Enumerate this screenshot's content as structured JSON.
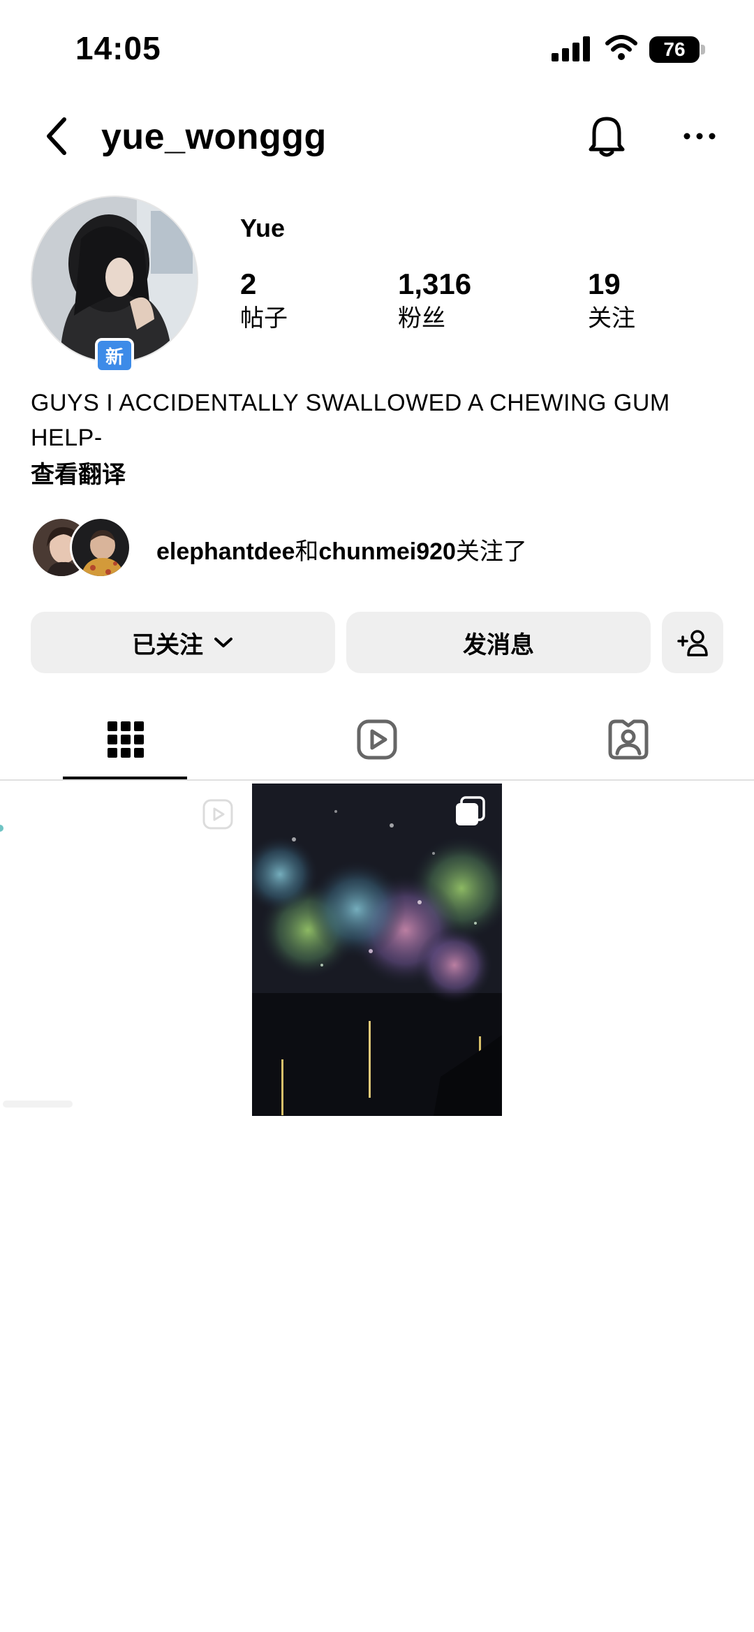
{
  "status_bar": {
    "time": "14:05",
    "battery": "76",
    "icons": [
      "signal-icon",
      "wifi-icon",
      "battery-icon"
    ]
  },
  "header": {
    "username": "yue_wonggg",
    "icons": [
      "back-arrow-icon",
      "bell-icon",
      "more-icon"
    ]
  },
  "profile": {
    "badge": "新",
    "display_name": "Yue",
    "stats": [
      {
        "value": "2",
        "label": "帖子"
      },
      {
        "value": "1,316",
        "label": "粉丝"
      },
      {
        "value": "19",
        "label": "关注"
      }
    ],
    "bio": "GUYS I ACCIDENTALLY SWALLOWED A CHEWING GUM HELP-",
    "translate_label": "查看翻译"
  },
  "mutuals": {
    "user1": "elephantdee",
    "conj": "和",
    "user2": "chunmei920",
    "suffix": "关注了"
  },
  "actions": {
    "following_label": "已关注",
    "message_label": "发消息",
    "icons": [
      "chevron-down-icon",
      "add-person-icon"
    ]
  },
  "tabs": [
    {
      "name": "posts-grid",
      "icon": "grid-icon",
      "active": true
    },
    {
      "name": "reels",
      "icon": "reels-icon",
      "active": false
    },
    {
      "name": "tagged",
      "icon": "tagged-icon",
      "active": false
    }
  ],
  "colors": {
    "badge_blue": "#3d8be8",
    "button_gray": "#efefef",
    "divider": "#e0e0e0"
  }
}
